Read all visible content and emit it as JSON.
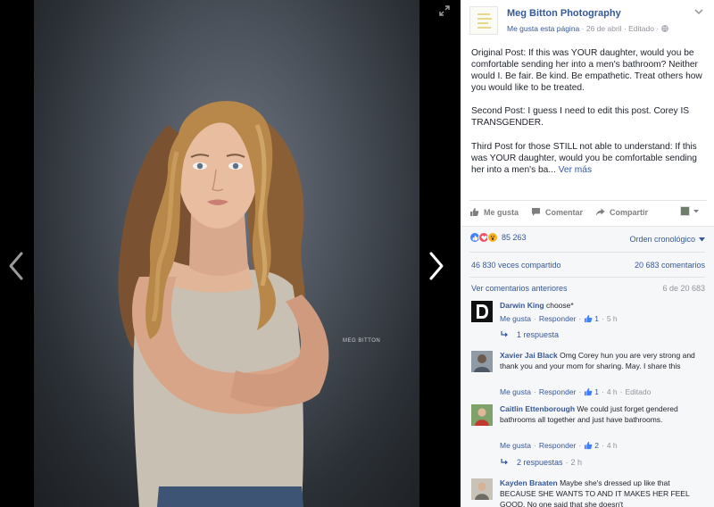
{
  "photo": {
    "watermark": "MEG BITTON"
  },
  "post": {
    "page_name": "Meg Bitton Photography",
    "like_page": "Me gusta esta página",
    "date": "26 de abril",
    "edited": "Editado",
    "paragraphs": [
      "Original Post: If this was YOUR daughter, would you be comfortable sending her into a men's bathroom? Neither would I. Be fair. Be kind. Be empathetic. Treat others how you would like to be treated.",
      "Second Post: I guess I need to edit this post. Corey IS TRANSGENDER.",
      "Third Post for those STILL not able to understand: If this was YOUR daughter, would you be comfortable sending her into a men's ba..."
    ],
    "see_more": "Ver más"
  },
  "actions": {
    "like": "Me gusta",
    "comment": "Comentar",
    "share": "Compartir"
  },
  "feedback": {
    "reactions_count": "85 263",
    "order": "Orden cronológico",
    "shares": "46 830 veces compartido",
    "comments_count": "20 683 comentarios",
    "previous_comments": "Ver comentarios anteriores",
    "range": "6 de 20 683"
  },
  "comments": [
    {
      "name": "Darwin King",
      "text": "choose*",
      "like": "Me gusta",
      "reply": "Responder",
      "likes": "1",
      "time": "5 h",
      "edited": "",
      "replies": "1 respuesta",
      "replies_time": ""
    },
    {
      "name": "Xavier Jai Black",
      "text": "Omg Corey hun you are very strong and thank you and your mom for sharing. May. I share this",
      "like": "Me gusta",
      "reply": "Responder",
      "likes": "1",
      "time": "4 h",
      "edited": "Editado",
      "replies": "",
      "replies_time": ""
    },
    {
      "name": "Caitlin Ettenborough",
      "text": "We could just forget gendered bathrooms all together and just have bathrooms.",
      "like": "Me gusta",
      "reply": "Responder",
      "likes": "2",
      "time": "4 h",
      "edited": "",
      "replies": "2 respuestas",
      "replies_time": "2 h"
    },
    {
      "name": "Kayden Braaten",
      "text": "Maybe she's dressed up like that BECAUSE SHE WANTS TO AND IT MAKES HER FEEL GOOD. No one said that she doesn't",
      "like": "",
      "reply": "",
      "likes": "",
      "time": "",
      "edited": "",
      "replies": "",
      "replies_time": ""
    }
  ],
  "colors": {
    "link": "#365899",
    "muted": "#90949c",
    "like_blue": "#4080ff",
    "love_red": "#f25268",
    "wow_yellow": "#f7b125"
  }
}
